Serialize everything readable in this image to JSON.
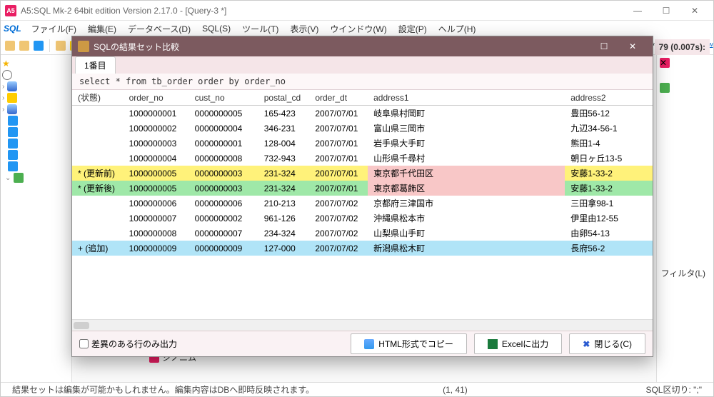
{
  "window": {
    "title": "A5:SQL Mk-2 64bit edition Version 2.17.0 - [Query-3 *]",
    "min": "—",
    "max": "☐",
    "close": "✕"
  },
  "menu": {
    "sql_badge": "SQL",
    "items": [
      "ファイル(F)",
      "編集(E)",
      "データベース(D)",
      "SQL(S)",
      "ツール(T)",
      "表示(V)",
      "ウインドウ(W)",
      "設定(P)",
      "ヘルプ(H)"
    ]
  },
  "tab_label_suffix": "3 *",
  "bg": {
    "timing": "79 (0.007s):",
    "filter": "フィルタ(L)",
    "synonym": "シノニム"
  },
  "status": {
    "left": "結果セットは編集が可能かもしれません。編集内容はDBへ即時反映されます。",
    "pos": "(1, 41)",
    "delim": "SQL区切り: \";\""
  },
  "dialog": {
    "title": "SQLの結果セット比較",
    "tab": "1番目",
    "sql": "select * from tb_order order by order_no",
    "columns": [
      "(状態)",
      "order_no",
      "cust_no",
      "postal_cd",
      "order_dt",
      "address1",
      "address2"
    ],
    "rows": [
      {
        "style": "normal",
        "state": "",
        "order_no": "1000000001",
        "cust_no": "0000000005",
        "postal_cd": "165-423",
        "order_dt": "2007/07/01",
        "addr1": "岐阜県村岡町",
        "addr2": "豊田56-12"
      },
      {
        "style": "normal",
        "state": "",
        "order_no": "1000000002",
        "cust_no": "0000000004",
        "postal_cd": "346-231",
        "order_dt": "2007/07/01",
        "addr1": "富山県三岡市",
        "addr2": "九辺34-56-1"
      },
      {
        "style": "normal",
        "state": "",
        "order_no": "1000000003",
        "cust_no": "0000000001",
        "postal_cd": "128-004",
        "order_dt": "2007/07/01",
        "addr1": "岩手県大手町",
        "addr2": "熊田1-4"
      },
      {
        "style": "normal",
        "state": "",
        "order_no": "1000000004",
        "cust_no": "0000000008",
        "postal_cd": "732-943",
        "order_dt": "2007/07/01",
        "addr1": "山形県千尋村",
        "addr2": "朝日ヶ丘13-5"
      },
      {
        "style": "before",
        "state": "* (更新前)",
        "order_no": "1000000005",
        "cust_no": "0000000003",
        "postal_cd": "231-324",
        "order_dt": "2007/07/01",
        "addr1": "東京都千代田区",
        "addr2": "安藤1-33-2"
      },
      {
        "style": "after",
        "state": "* (更新後)",
        "order_no": "1000000005",
        "cust_no": "0000000003",
        "postal_cd": "231-324",
        "order_dt": "2007/07/01",
        "addr1": "東京都葛飾区",
        "addr2": "安藤1-33-2"
      },
      {
        "style": "normal",
        "state": "",
        "order_no": "1000000006",
        "cust_no": "0000000006",
        "postal_cd": "210-213",
        "order_dt": "2007/07/02",
        "addr1": "京都府三津国市",
        "addr2": "三田拿98-1"
      },
      {
        "style": "normal",
        "state": "",
        "order_no": "1000000007",
        "cust_no": "0000000002",
        "postal_cd": "961-126",
        "order_dt": "2007/07/02",
        "addr1": "沖縄県松本市",
        "addr2": "伊里由12-55"
      },
      {
        "style": "normal",
        "state": "",
        "order_no": "1000000008",
        "cust_no": "0000000007",
        "postal_cd": "234-324",
        "order_dt": "2007/07/02",
        "addr1": "山梨県山手町",
        "addr2": "由卵54-13"
      },
      {
        "style": "added",
        "state": "+ (追加)",
        "order_no": "1000000009",
        "cust_no": "0000000009",
        "postal_cd": "127-000",
        "order_dt": "2007/07/02",
        "addr1": "新潟県松木町",
        "addr2": "長府56-2"
      }
    ],
    "footer": {
      "checkbox": "差異のある行のみ出力",
      "btn_html": "HTML形式でコピー",
      "btn_excel": "Excelに出力",
      "btn_close": "閉じる(C)"
    }
  }
}
